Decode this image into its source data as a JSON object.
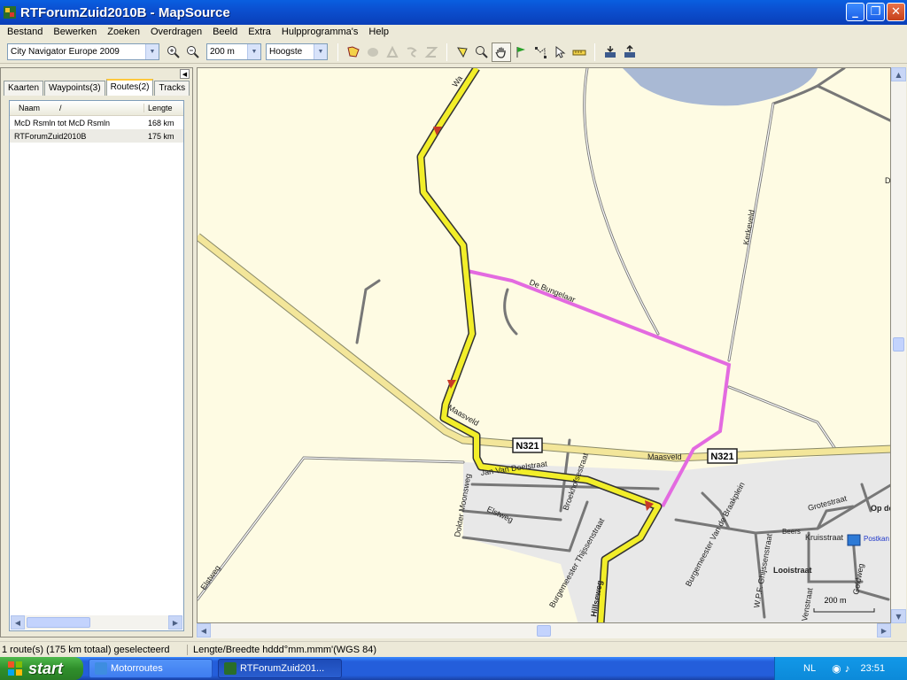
{
  "window": {
    "title": "RTForumZuid2010B - MapSource",
    "minimize_glyph": "_",
    "maximize_glyph": "❐",
    "close_glyph": "✕"
  },
  "menu": [
    "Bestand",
    "Bewerken",
    "Zoeken",
    "Overdragen",
    "Beeld",
    "Extra",
    "Hulpprogramma's",
    "Help"
  ],
  "toolbar": {
    "map_product": "City Navigator Europe 2009",
    "zoom_level": "200 m",
    "detail_level": "Hoogste"
  },
  "sidebar": {
    "tabs": [
      "Kaarten",
      "Waypoints(3)",
      "Routes(2)",
      "Tracks"
    ],
    "active_tab": 2,
    "columns": {
      "name": "Naam",
      "sort_glyph": "/",
      "length": "Lengte"
    },
    "rows": [
      {
        "name": "McD Rsmln tot McD Rsmln",
        "length": "168 km"
      },
      {
        "name": "RTForumZuid2010B",
        "length": "175 km"
      }
    ],
    "selected_row": 1
  },
  "map": {
    "road_badges": [
      "N321",
      "N321"
    ],
    "street_labels": {
      "de_bungelaar": "De Bungelaar",
      "kerkeveld": "Kerkeveld",
      "maasveld_w": "Maasveld",
      "maasveld_e": "Maasveld",
      "elstweg_a": "Elstweg",
      "elstweg_b": "Elstweg",
      "jan_van_doelstraat": "Jan Van Doelstraat",
      "dokter_moonsweg": "Dokter Moonsweg",
      "broekhoflaan": "Broekhofsestraat",
      "burgemeester_thijssenstraat": "Burgemeester Thijssenstraat",
      "burgemeester_van_de_braakplein": "Burgemeester Van de Braakplein",
      "wpf_ghijssenstraat": "W.P.F. Ghijssenstraat",
      "grotestraat": "Grotestraat",
      "kruisstraat": "Kruisstraat",
      "looistraat": "Looistraat",
      "venstraat": "Venstraat",
      "goldweg": "Goldweg",
      "op_de": "Op de",
      "beers": "Beers",
      "postkantoor": "Postkan",
      "hillseweg": "Hillseweg",
      "top_road": "Wa",
      "edge_d": "D"
    },
    "scale_label": "200 m",
    "colors": {
      "route": "#f2ee29",
      "route_edge": "#333333",
      "pink": "#e36ae0",
      "water": "#a9b9d4",
      "built": "#e8e8e8"
    }
  },
  "status": {
    "selection": "1 route(s) (175 km totaal) geselecteerd",
    "coords": "Lengte/Breedte hddd°mm.mmm'(WGS 84)"
  },
  "taskbar": {
    "start": "start",
    "items": [
      "Motorroutes",
      "RTForumZuid201..."
    ],
    "lang": "NL",
    "time": "23:51"
  }
}
